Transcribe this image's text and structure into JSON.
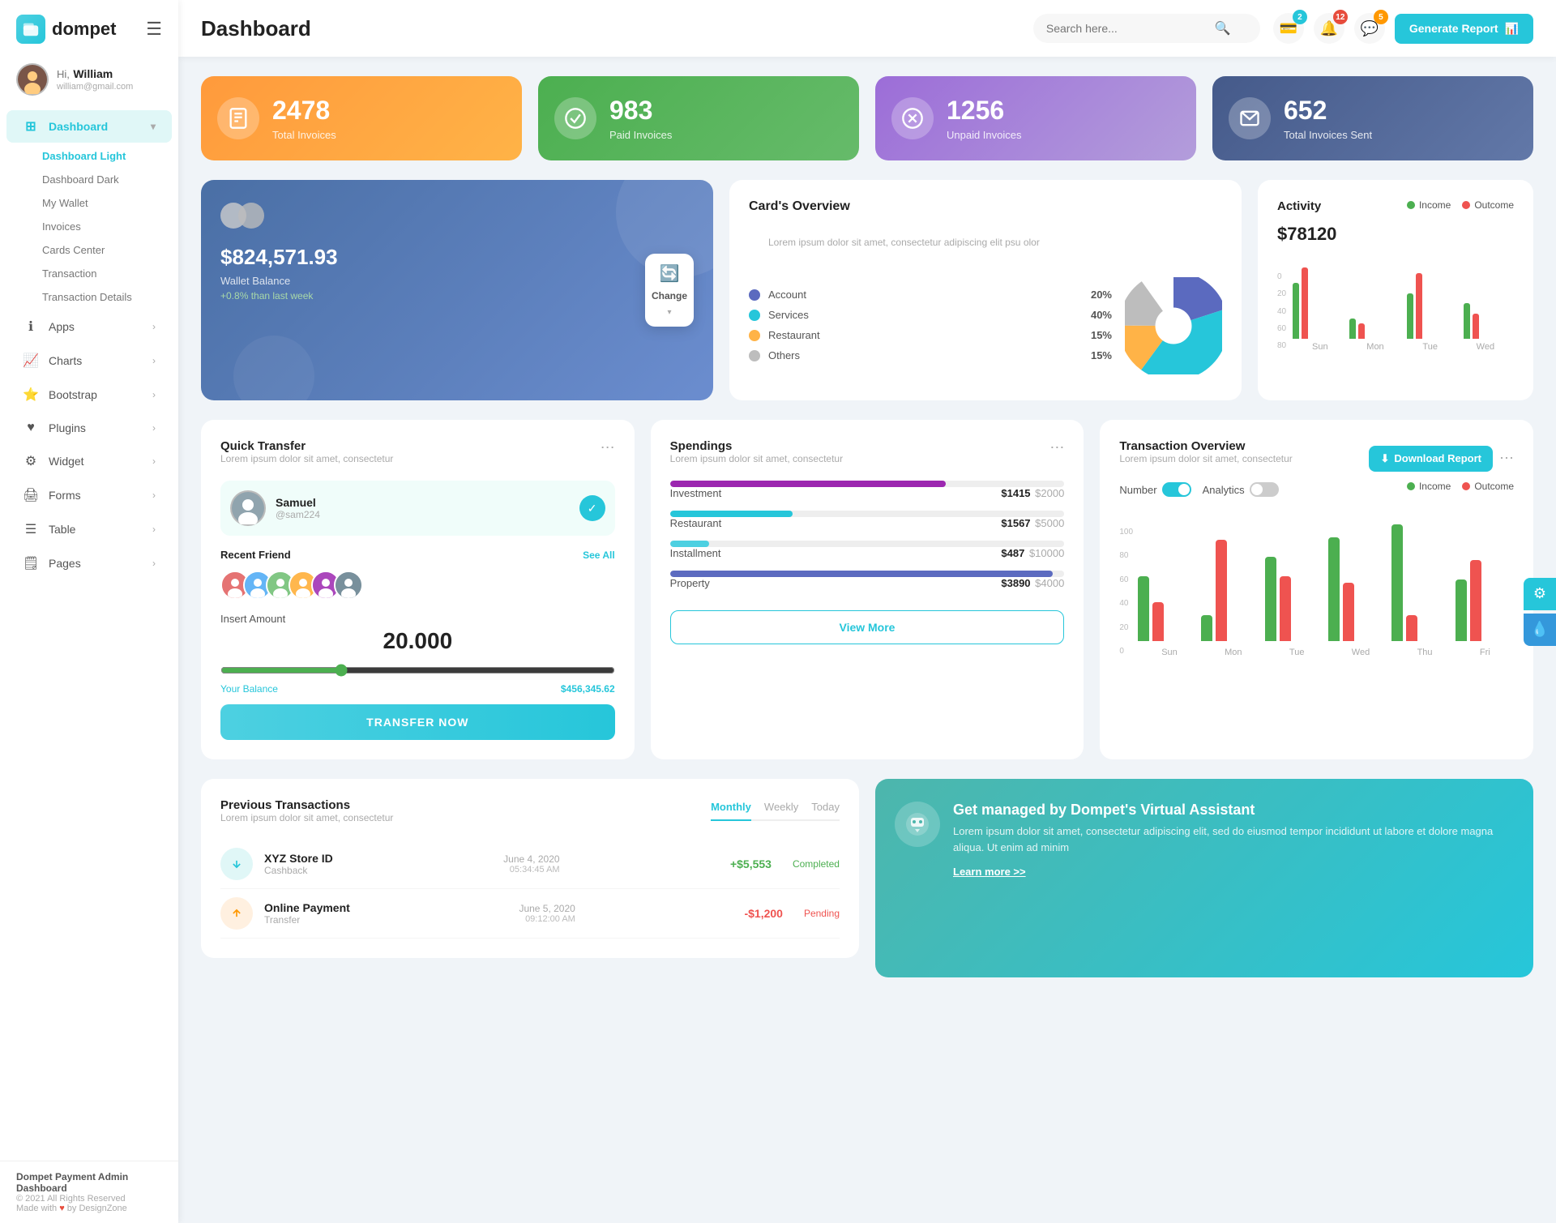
{
  "app": {
    "logo_text": "dompet",
    "logo_icon": "💳"
  },
  "header": {
    "title": "Dashboard",
    "search_placeholder": "Search here...",
    "generate_btn": "Generate Report"
  },
  "header_icons": {
    "wallet_badge": "2",
    "bell_badge": "12",
    "chat_badge": "5"
  },
  "user": {
    "greeting": "Hi,",
    "name": "William",
    "email": "william@gmail.com"
  },
  "sidebar": {
    "dashboard_label": "Dashboard",
    "submenu": [
      {
        "label": "Dashboard Light",
        "active": true
      },
      {
        "label": "Dashboard Dark"
      },
      {
        "label": "My Wallet"
      },
      {
        "label": "Invoices"
      },
      {
        "label": "Cards Center"
      },
      {
        "label": "Transaction"
      },
      {
        "label": "Transaction Details"
      }
    ],
    "nav_items": [
      {
        "label": "Apps",
        "icon": "ℹ"
      },
      {
        "label": "Charts",
        "icon": "📈"
      },
      {
        "label": "Bootstrap",
        "icon": "⭐"
      },
      {
        "label": "Plugins",
        "icon": "♥"
      },
      {
        "label": "Widget",
        "icon": "⚙"
      },
      {
        "label": "Forms",
        "icon": "🖨"
      },
      {
        "label": "Table",
        "icon": "☰"
      },
      {
        "label": "Pages",
        "icon": "🗒"
      }
    ]
  },
  "sidebar_footer": {
    "brand": "Dompet Payment Admin Dashboard",
    "year": "© 2021 All Rights Reserved",
    "made_with": "Made with",
    "by": "by DesignZone"
  },
  "stat_cards": [
    {
      "number": "2478",
      "label": "Total Invoices",
      "color": "orange",
      "icon": "📋"
    },
    {
      "number": "983",
      "label": "Paid Invoices",
      "color": "green",
      "icon": "✅"
    },
    {
      "number": "1256",
      "label": "Unpaid Invoices",
      "color": "purple",
      "icon": "❌"
    },
    {
      "number": "652",
      "label": "Total Invoices Sent",
      "color": "blue",
      "icon": "📤"
    }
  ],
  "wallet": {
    "amount": "$824,571.93",
    "label": "Wallet Balance",
    "change": "+0.8% than last week",
    "change_btn_label": "Change"
  },
  "cards_overview": {
    "title": "Card's Overview",
    "subtitle": "Lorem ipsum dolor sit amet, consectetur adipiscing elit psu olor",
    "items": [
      {
        "label": "Account",
        "pct": "20%",
        "color": "#5b6abf"
      },
      {
        "label": "Services",
        "pct": "40%",
        "color": "#26c6da"
      },
      {
        "label": "Restaurant",
        "pct": "15%",
        "color": "#ffb347"
      },
      {
        "label": "Others",
        "pct": "15%",
        "color": "#bdbdbd"
      }
    ]
  },
  "activity": {
    "title": "Activity",
    "amount": "$78120",
    "income_label": "Income",
    "outcome_label": "Outcome",
    "income_color": "#4caf50",
    "outcome_color": "#ef5350",
    "days": [
      "Sun",
      "Mon",
      "Tue",
      "Wed"
    ],
    "bars": [
      {
        "income": 55,
        "outcome": 70
      },
      {
        "income": 20,
        "outcome": 15
      },
      {
        "income": 45,
        "outcome": 65
      },
      {
        "income": 35,
        "outcome": 25
      }
    ],
    "y_labels": [
      "80",
      "60",
      "40",
      "20",
      "0"
    ]
  },
  "quick_transfer": {
    "title": "Quick Transfer",
    "subtitle": "Lorem ipsum dolor sit amet, consectetur",
    "active_user": {
      "name": "Samuel",
      "id": "@sam224"
    },
    "recent_label": "Recent Friend",
    "see_all": "See All",
    "insert_label": "Insert Amount",
    "amount": "20.000",
    "balance_label": "Your Balance",
    "balance": "$456,345.62",
    "transfer_btn": "TRANSFER NOW",
    "friends": [
      "👤",
      "👤",
      "👤",
      "👤",
      "👤",
      "👤"
    ]
  },
  "spendings": {
    "title": "Spendings",
    "subtitle": "Lorem ipsum dolor sit amet, consectetur",
    "items": [
      {
        "label": "Investment",
        "amount": "$1415",
        "total": "$2000",
        "pct": 70,
        "color": "#9c27b0"
      },
      {
        "label": "Restaurant",
        "amount": "$1567",
        "total": "$5000",
        "pct": 31,
        "color": "#26c6da"
      },
      {
        "label": "Installment",
        "amount": "$487",
        "total": "$10000",
        "pct": 10,
        "color": "#4dd0e1"
      },
      {
        "label": "Property",
        "amount": "$3890",
        "total": "$4000",
        "pct": 97,
        "color": "#5c6bc0"
      }
    ],
    "view_more": "View More"
  },
  "transaction_overview": {
    "title": "Transaction Overview",
    "subtitle": "Lorem ipsum dolor sit amet, consectetur",
    "download_btn": "Download Report",
    "number_label": "Number",
    "analytics_label": "Analytics",
    "income_label": "Income",
    "outcome_label": "Outcome",
    "days": [
      "Sun",
      "Mon",
      "Tue",
      "Wed",
      "Thu",
      "Fri"
    ],
    "bars": [
      {
        "income": 50,
        "outcome": 30
      },
      {
        "income": 20,
        "outcome": 78
      },
      {
        "income": 65,
        "outcome": 50
      },
      {
        "income": 80,
        "outcome": 45
      },
      {
        "income": 90,
        "outcome": 20
      },
      {
        "income": 48,
        "outcome": 62
      }
    ],
    "y_labels": [
      "100",
      "80",
      "60",
      "40",
      "20",
      "0"
    ]
  },
  "prev_transactions": {
    "title": "Previous Transactions",
    "subtitle": "Lorem ipsum dolor sit amet, consectetur",
    "tabs": [
      "Monthly",
      "Weekly",
      "Today"
    ],
    "active_tab": "Monthly",
    "rows": [
      {
        "icon": "⬇",
        "name": "XYZ Store ID",
        "type": "Cashback",
        "date": "June 4, 2020",
        "time": "05:34:45 AM",
        "amount": "+$5,553",
        "status": "Completed",
        "color": "#26c6da"
      }
    ]
  },
  "virtual_assistant": {
    "icon": "💰",
    "title": "Get managed by Dompet's Virtual Assistant",
    "text": "Lorem ipsum dolor sit amet, consectetur adipiscing elit, sed do eiusmod tempor incididunt ut labore et dolore magna aliqua. Ut enim ad minim",
    "link": "Learn more >>"
  }
}
